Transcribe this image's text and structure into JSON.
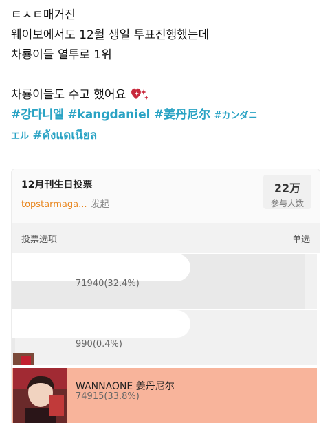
{
  "post": {
    "lines": [
      "ㅌㅅㅌ매거진",
      "웨이보에서도 12월 생일 투표진행했는데",
      "차룡이들 열투로 1위"
    ],
    "thanks": "차룡이들도 수고 했어요",
    "hashtags_line1": [
      "#강다니엘",
      "#kangdaniel",
      "#姜丹尼尔",
      "#カンダニ"
    ],
    "hashtags_line2": [
      "エル",
      "#คังแดเนียล"
    ],
    "colors": {
      "hashtag": "#2aa3c4",
      "heart": "#c8283c"
    }
  },
  "poll": {
    "title": "12月刊生日投票",
    "author": "topstarmaga...",
    "action": "发起",
    "count": "22万",
    "count_label": "参与人数",
    "type_label": "投票选项",
    "mode": "单选",
    "options": [
      {
        "name": "",
        "votes": "71940(32.4%)",
        "fill_percent": 32.4
      },
      {
        "name": "",
        "votes": "990(0.4%)",
        "fill_percent": 0.4
      },
      {
        "name": "WANNAONE 姜丹尼尔",
        "votes": "74915(33.8%)",
        "fill_percent": 33.8,
        "highlight_color": "#f8b49b"
      }
    ]
  }
}
